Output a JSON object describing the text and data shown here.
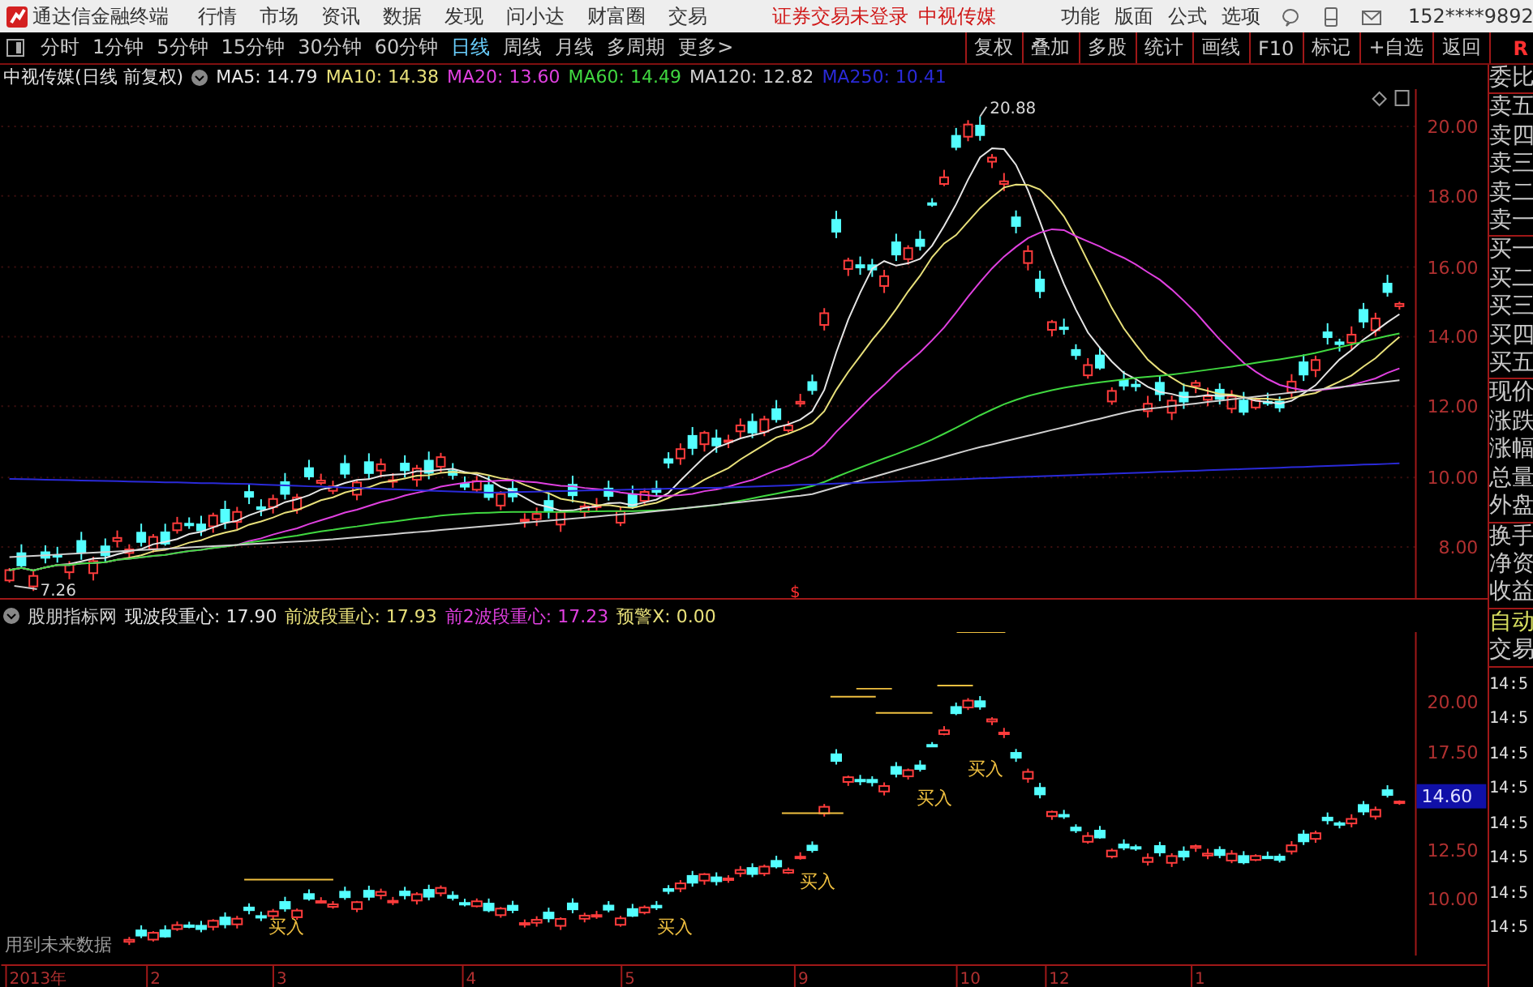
{
  "app": {
    "title": "通达信金融终端"
  },
  "menu": [
    "行情",
    "市场",
    "资讯",
    "数据",
    "发现",
    "问小达",
    "财富圈",
    "交易"
  ],
  "login_status": "证券交易未登录",
  "stock_link": "中视传媒",
  "right_menu": [
    "功能",
    "版面",
    "公式",
    "选项"
  ],
  "account": "152****9892",
  "periods": [
    {
      "label": "分时",
      "selected": false
    },
    {
      "label": "1分钟",
      "selected": false
    },
    {
      "label": "5分钟",
      "selected": false
    },
    {
      "label": "15分钟",
      "selected": false
    },
    {
      "label": "30分钟",
      "selected": false
    },
    {
      "label": "60分钟",
      "selected": false
    },
    {
      "label": "日线",
      "selected": true
    },
    {
      "label": "周线",
      "selected": false
    },
    {
      "label": "月线",
      "selected": false
    },
    {
      "label": "多周期",
      "selected": false
    },
    {
      "label": "更多>",
      "selected": false
    }
  ],
  "tools": [
    "复权",
    "叠加",
    "多股",
    "统计",
    "画线",
    "F10",
    "标记",
    "+自选",
    "返回"
  ],
  "tool_tail": "R",
  "chart_title": "中视传媒(日线 前复权)",
  "ma_legend": [
    {
      "label": "MA5: 14.79",
      "color": "#e6e6e6"
    },
    {
      "label": "MA10: 14.38",
      "color": "#e8e07a"
    },
    {
      "label": "MA20: 13.60",
      "color": "#e040e0"
    },
    {
      "label": "MA60: 14.49",
      "color": "#40d840"
    },
    {
      "label": "MA120: 12.82",
      "color": "#d0d0d0"
    },
    {
      "label": "MA250: 10.41",
      "color": "#2a2ad8"
    }
  ],
  "price_axis": [
    "20.00",
    "18.00",
    "16.00",
    "14.00",
    "12.00",
    "10.00",
    "8.00"
  ],
  "annotations": [
    {
      "kind": "high",
      "text": "20.88"
    },
    {
      "kind": "low",
      "text": "7.26"
    }
  ],
  "event_marker": "$",
  "indicator": {
    "name": "股朋指标网",
    "values": [
      {
        "label": "现波段重心: 17.90",
        "color": "#e6e6e6"
      },
      {
        "label": "前波段重心: 17.93",
        "color": "#e8e07a"
      },
      {
        "label": "前2波段重心: 17.23",
        "color": "#e040e0"
      },
      {
        "label": "预警X: 0.00",
        "color": "#e8e07a"
      }
    ]
  },
  "lower_axis": {
    "ticks": [
      "20.00",
      "17.50",
      "12.50",
      "10.00"
    ],
    "current": "14.60"
  },
  "signals": [
    "买入",
    "买入",
    "买入",
    "买入",
    "买入"
  ],
  "warning": "用到未来数据",
  "date_axis": [
    "2013年",
    "2",
    "3",
    "4",
    "5",
    "9",
    "10",
    "12",
    "1"
  ],
  "quote_groups": [
    [
      "委比"
    ],
    [
      "卖五",
      "卖四",
      "卖三",
      "卖二",
      "卖一"
    ],
    [
      "买一",
      "买二",
      "买三",
      "买四",
      "买五"
    ],
    [
      "现价",
      "涨跌",
      "涨幅",
      "总量",
      "外盘"
    ],
    [
      "换手",
      "净资",
      "收益"
    ]
  ],
  "trade_tabs": [
    {
      "label": "自动",
      "selected": true
    },
    {
      "label": "交易",
      "selected": false
    }
  ],
  "trade_times": [
    "14:5",
    "14:5",
    "14:5",
    "14:5",
    "14:5",
    "14:5",
    "14:5",
    "14:5"
  ]
}
